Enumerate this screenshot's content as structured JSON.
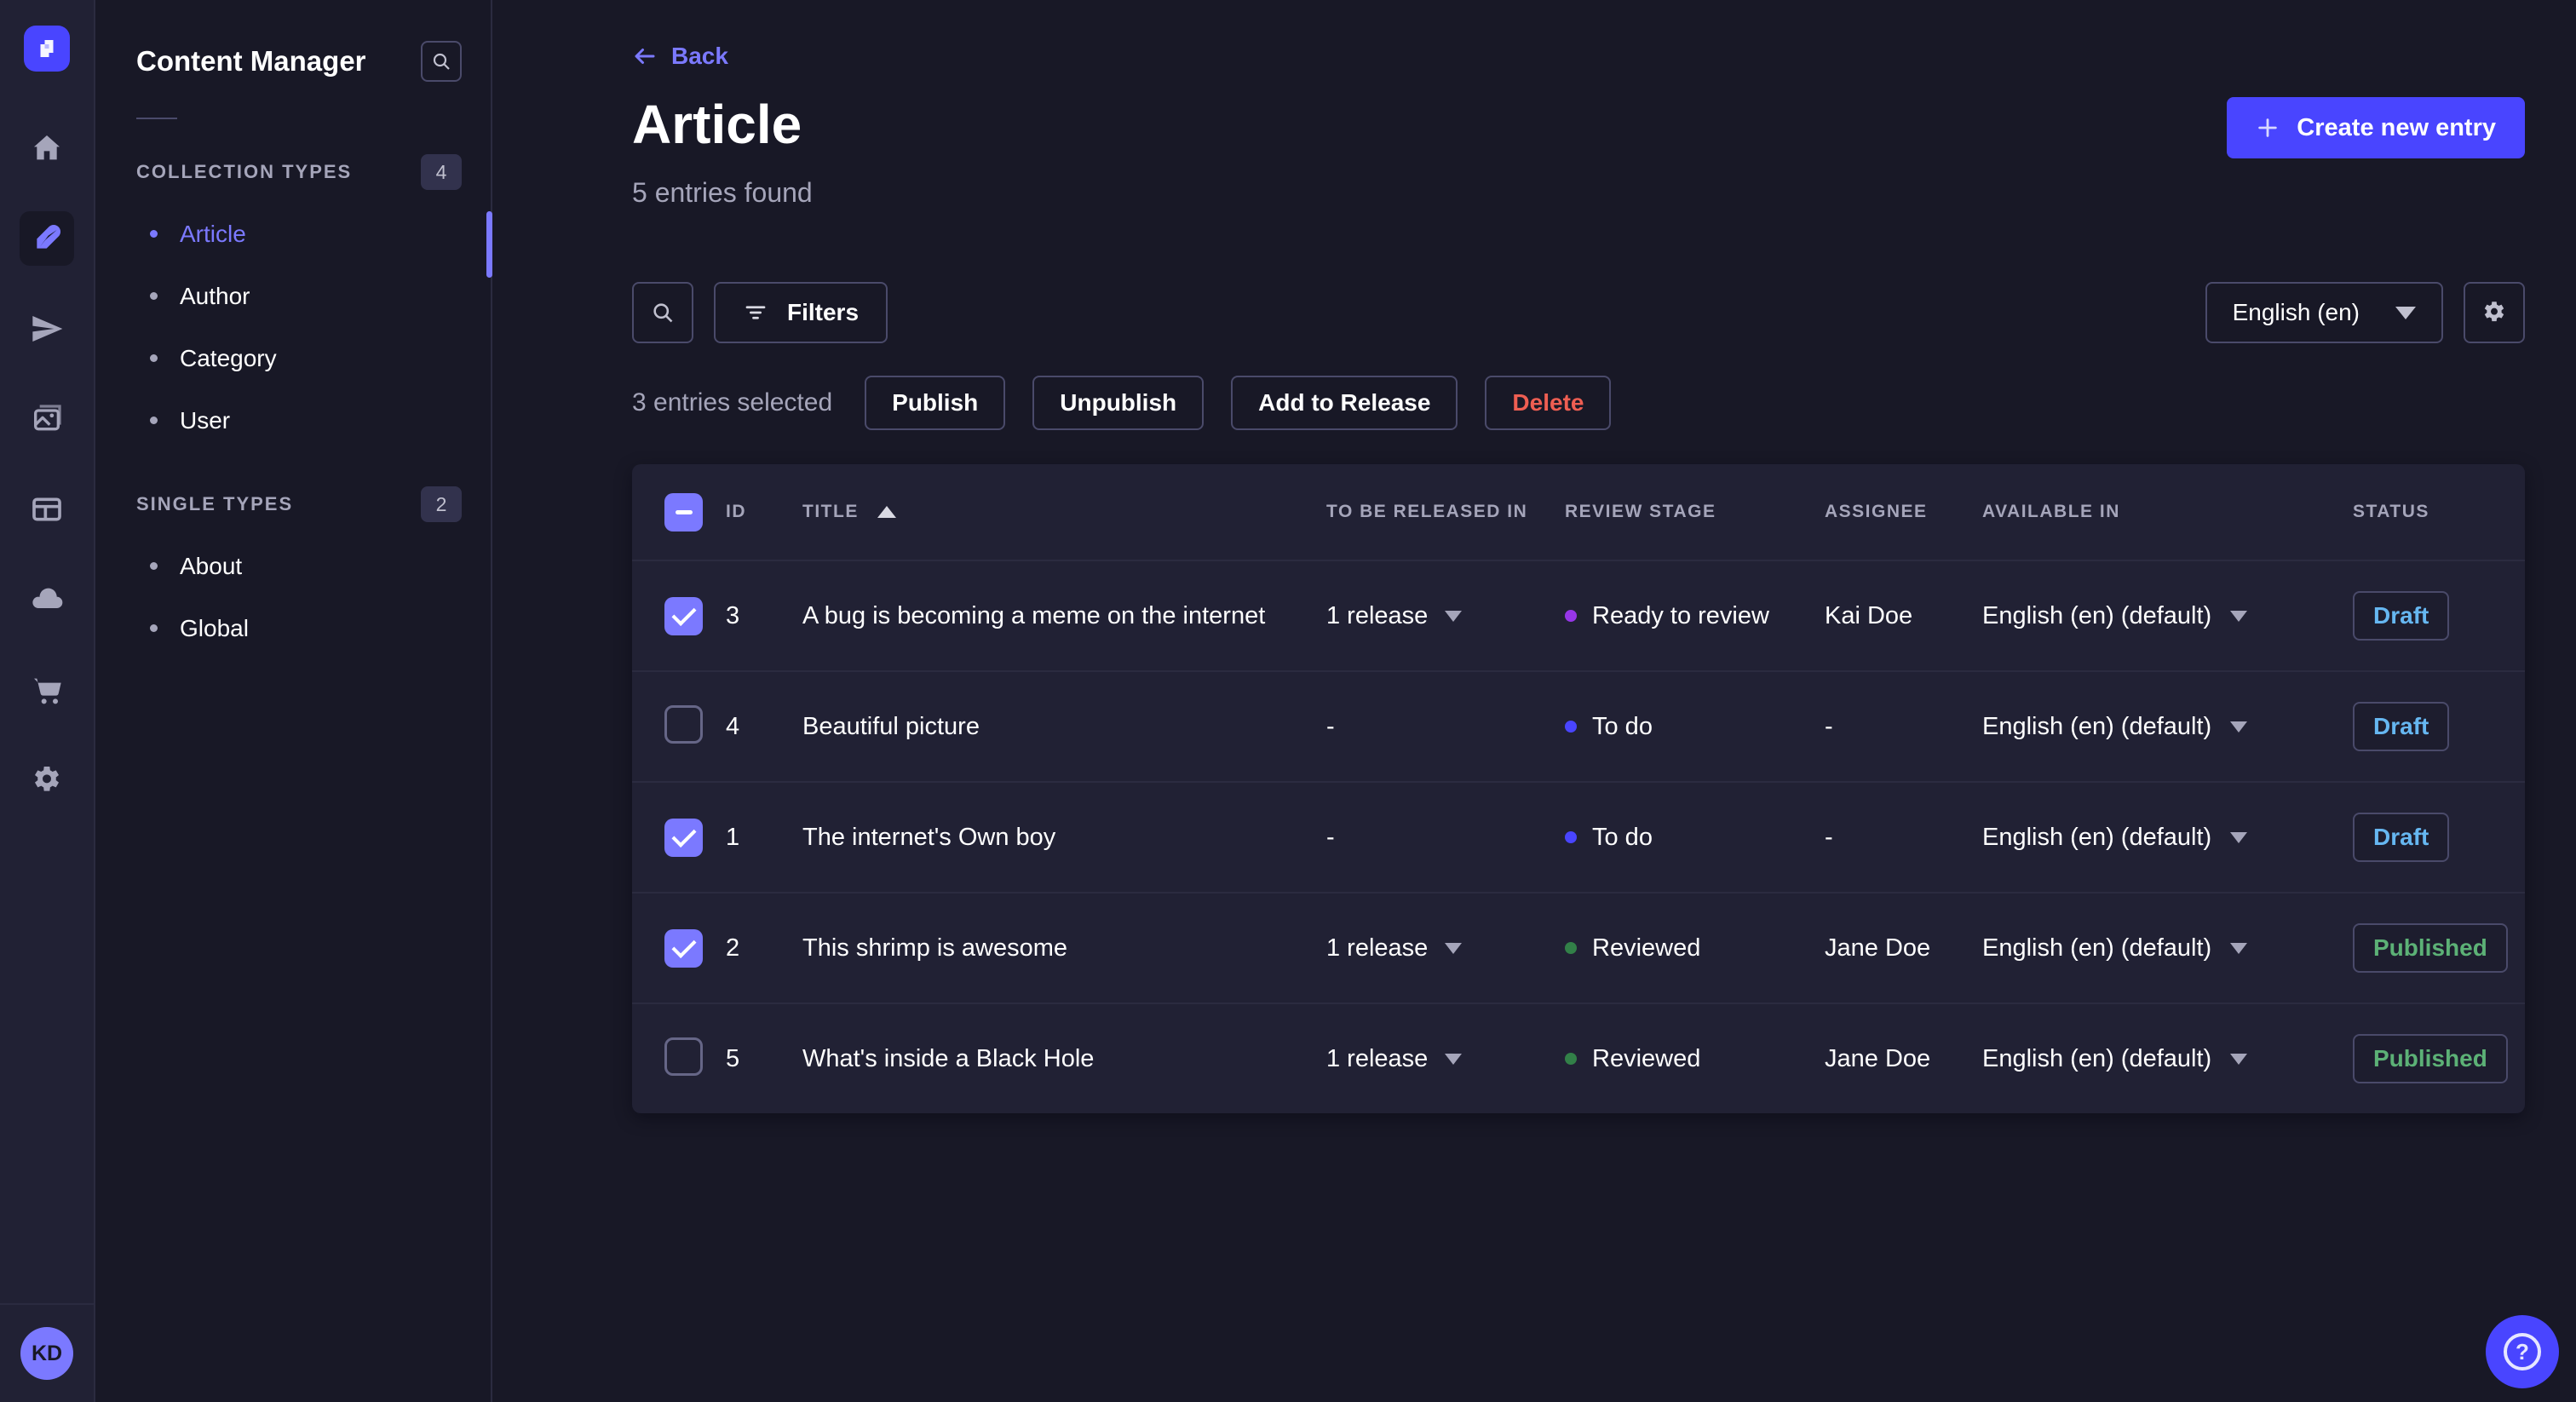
{
  "rail": {
    "avatar_initials": "KD",
    "icons": [
      "strapi-logo",
      "home",
      "content-manager-feather",
      "releases-plane",
      "media-library",
      "content-type-builder",
      "cloud-deploy",
      "marketplace-cart",
      "settings-gear"
    ]
  },
  "sidebar": {
    "title": "Content Manager",
    "search_icon": "search-icon",
    "sections": [
      {
        "label": "COLLECTION TYPES",
        "count": "4",
        "items": [
          {
            "label": "Article",
            "active": true
          },
          {
            "label": "Author",
            "active": false
          },
          {
            "label": "Category",
            "active": false
          },
          {
            "label": "User",
            "active": false
          }
        ]
      },
      {
        "label": "SINGLE TYPES",
        "count": "2",
        "items": [
          {
            "label": "About",
            "active": false
          },
          {
            "label": "Global",
            "active": false
          }
        ]
      }
    ]
  },
  "header": {
    "back": "Back",
    "title": "Article",
    "subtitle": "5 entries found",
    "create_button": "Create new entry"
  },
  "toolbar": {
    "filters_label": "Filters",
    "locale_value": "English (en)"
  },
  "selection": {
    "text": "3 entries selected",
    "publish": "Publish",
    "unpublish": "Unpublish",
    "add_to_release": "Add to Release",
    "delete": "Delete"
  },
  "table": {
    "headers": [
      "ID",
      "TITLE",
      "TO BE RELEASED IN",
      "REVIEW STAGE",
      "ASSIGNEE",
      "AVAILABLE IN",
      "STATUS"
    ],
    "rows": [
      {
        "checked": true,
        "id": "3",
        "title": "A bug is becoming a meme on the internet",
        "released_in": "1 release",
        "stage": "Ready to review",
        "stage_color": "#9736e8",
        "assignee": "Kai Doe",
        "available_in": "English (en) (default)",
        "status": "Draft"
      },
      {
        "checked": false,
        "id": "4",
        "title": "Beautiful picture",
        "released_in": "-",
        "stage": "To do",
        "stage_color": "#4945ff",
        "assignee": "-",
        "available_in": "English (en) (default)",
        "status": "Draft"
      },
      {
        "checked": true,
        "id": "1",
        "title": "The internet's Own boy",
        "released_in": "-",
        "stage": "To do",
        "stage_color": "#4945ff",
        "assignee": "-",
        "available_in": "English (en) (default)",
        "status": "Draft"
      },
      {
        "checked": true,
        "id": "2",
        "title": "This shrimp is awesome",
        "released_in": "1 release",
        "stage": "Reviewed",
        "stage_color": "#328048",
        "assignee": "Jane Doe",
        "available_in": "English (en) (default)",
        "status": "Published"
      },
      {
        "checked": false,
        "id": "5",
        "title": "What's inside a Black Hole",
        "released_in": "1 release",
        "stage": "Reviewed",
        "stage_color": "#328048",
        "assignee": "Jane Doe",
        "available_in": "English (en) (default)",
        "status": "Published"
      }
    ]
  },
  "colors": {
    "page_bg": "#181826",
    "panel_bg": "#212134",
    "accent": "#4945ff",
    "accent_light": "#7b79ff",
    "text_secondary": "#a5a5ba",
    "border": "#4a4a6a",
    "draft": "#66b7f1",
    "published": "#5cb176",
    "danger": "#ee5e52"
  }
}
